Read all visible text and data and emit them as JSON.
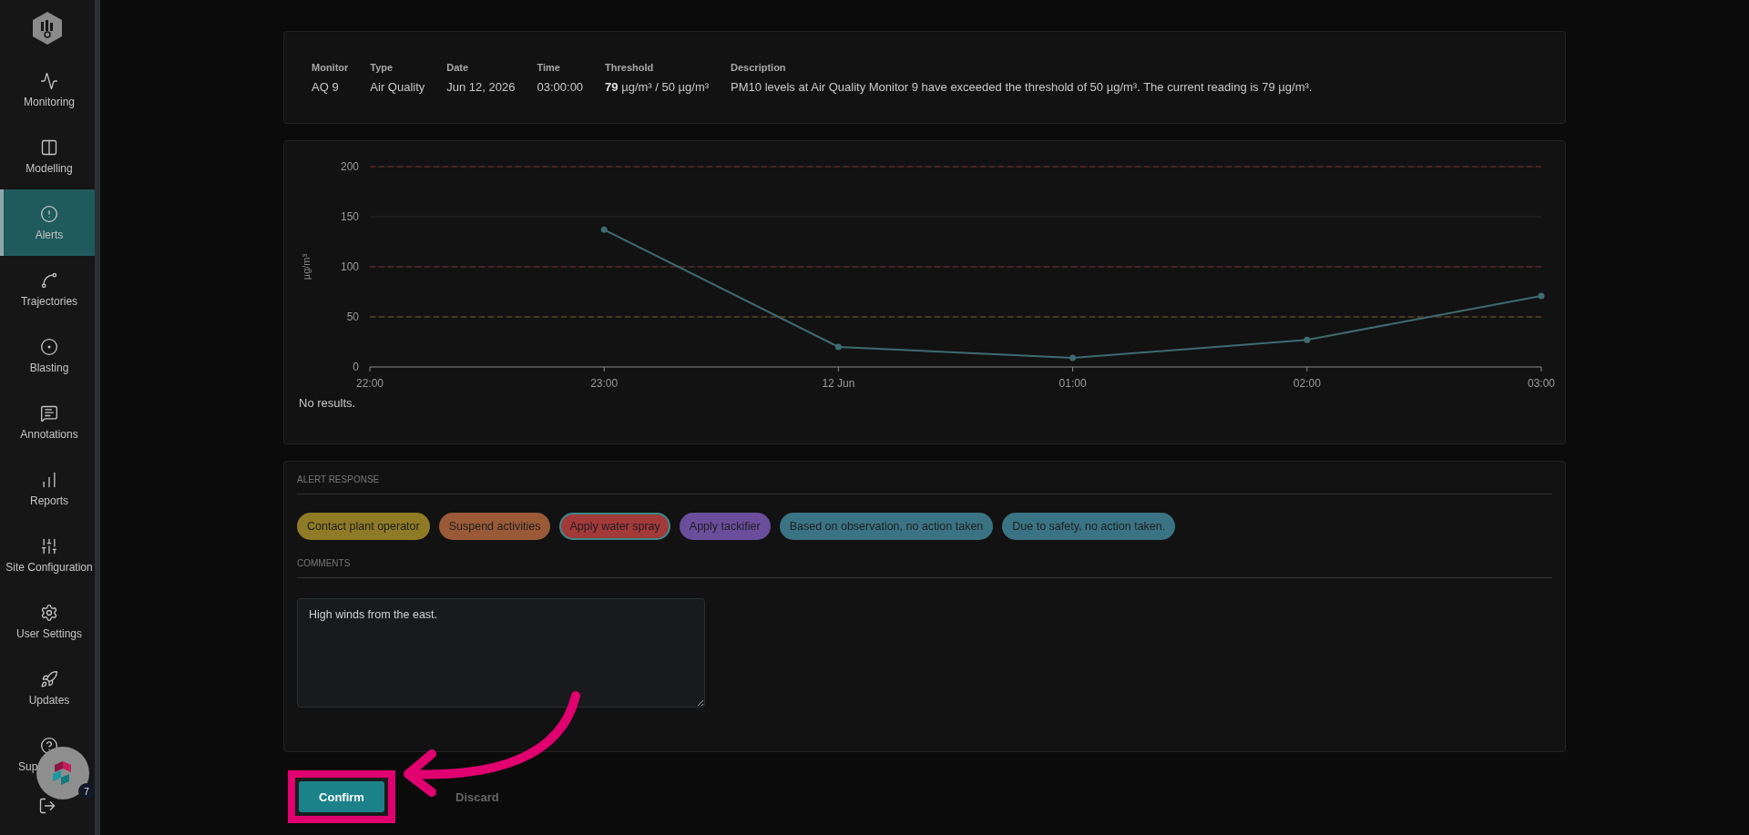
{
  "sidebar": {
    "items": [
      {
        "label": "Monitoring",
        "selected": false
      },
      {
        "label": "Modelling",
        "selected": false
      },
      {
        "label": "Alerts",
        "selected": true
      },
      {
        "label": "Trajectories",
        "selected": false
      },
      {
        "label": "Blasting",
        "selected": false
      },
      {
        "label": "Annotations",
        "selected": false
      },
      {
        "label": "Reports",
        "selected": false
      },
      {
        "label": "Site Configuration",
        "selected": false
      },
      {
        "label": "User Settings",
        "selected": false
      },
      {
        "label": "Updates",
        "selected": false
      },
      {
        "label": "Sup",
        "selected": false
      }
    ],
    "help_widget": {
      "badge": "7"
    }
  },
  "alert": {
    "fields": [
      {
        "label": "Monitor",
        "value": "AQ 9"
      },
      {
        "label": "Type",
        "value": "Air Quality"
      },
      {
        "label": "Date",
        "value": "Jun 12, 2026"
      },
      {
        "label": "Time",
        "value": "03:00:00"
      },
      {
        "label": "Threshold",
        "value": "**79** µg/m³ / 50 µg/m³"
      },
      {
        "label": "Description",
        "value": "PM10 levels at Air Quality Monitor 9 have exceeded the threshold of 50 µg/m³. The current reading is 79 µg/m³."
      }
    ]
  },
  "chart": {
    "chart_data": {
      "type": "line",
      "ylabel": "µg/m³",
      "categories": [
        "22:00",
        "23:00",
        "12 Jun",
        "01:00",
        "02:00",
        "03:00"
      ],
      "series": [
        {
          "color": "#3f6b70",
          "marker": "o",
          "values": [
            null,
            137,
            20,
            9,
            27,
            71
          ]
        }
      ],
      "ylim": [
        0,
        200
      ],
      "yticks": [
        0,
        50,
        100,
        150,
        200
      ],
      "grid": true,
      "ref_lines": [
        {
          "axis": "y",
          "value": 200,
          "color": "#7a2a2a"
        },
        {
          "axis": "y",
          "value": 100,
          "color": "#6e2e2e"
        },
        {
          "axis": "y",
          "value": 50,
          "color": "#6e5a26"
        }
      ]
    },
    "message": "No results."
  },
  "response": {
    "title": "ALERT RESPONSE",
    "actions": [
      {
        "label": "Contact plant operator",
        "color": "#8f7a26",
        "selected": false
      },
      {
        "label": "Suspend activities",
        "color": "#9a5a38",
        "selected": false
      },
      {
        "label": "Apply water spray",
        "color": "#a33a3a",
        "selected": true
      },
      {
        "label": "Apply tackifier",
        "color": "#6a4e9c",
        "selected": false
      },
      {
        "label": "Based on observation, no action taken",
        "color": "#3a7484",
        "selected": false
      },
      {
        "label": "Due to safety, no action taken.",
        "color": "#3a7484",
        "selected": false
      }
    ],
    "comments_title": "COMMENTS",
    "comment": "High winds from the east."
  },
  "buttons": [
    {
      "label": "Confirm",
      "kind": "primary"
    },
    {
      "label": "Discard",
      "kind": "text"
    }
  ]
}
